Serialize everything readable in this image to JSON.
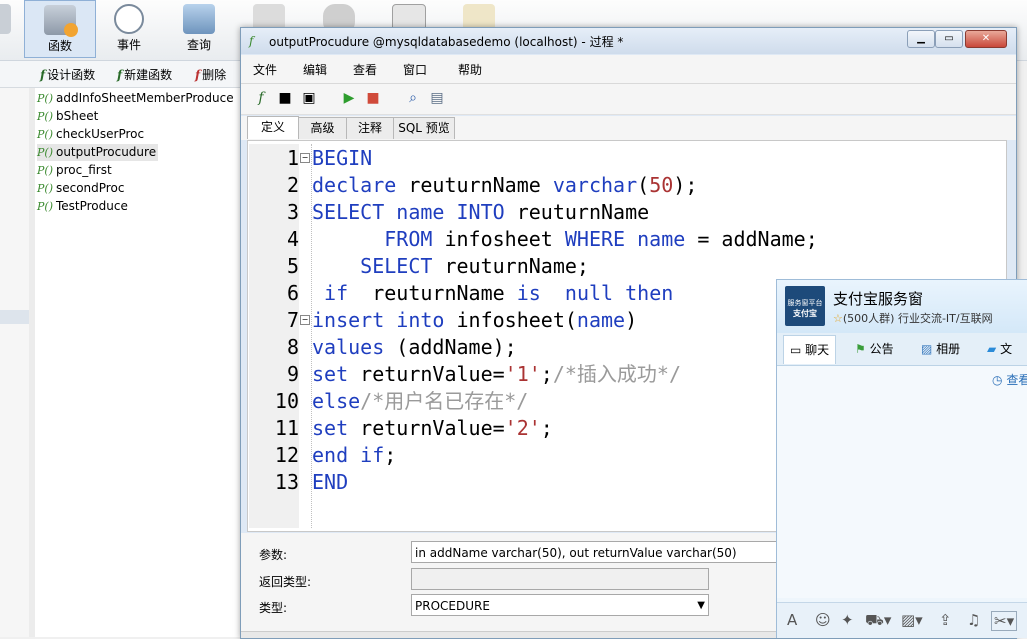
{
  "background_app": {
    "toolbar": [
      {
        "label": "函数",
        "active": true
      },
      {
        "label": "事件",
        "active": false
      },
      {
        "label": "查询",
        "active": false
      }
    ],
    "subbar": {
      "design": "设计函数",
      "new": "新建函数",
      "delete": "删除"
    },
    "procedures": [
      "addInfoSheetMemberProduce",
      "bSheet",
      "checkUserProc",
      "outputProcudure",
      "proc_first",
      "secondProc",
      "TestProduce"
    ],
    "selected_procedure": "outputProcudure"
  },
  "window": {
    "title": "outputProcudure @mysqldatabasedemo (localhost) - 过程 *",
    "menu": [
      "文件",
      "编辑",
      "查看",
      "窗口",
      "帮助"
    ],
    "tabs": [
      {
        "label": "定义",
        "active": true
      },
      {
        "label": "高级",
        "active": false
      },
      {
        "label": "注释",
        "active": false
      },
      {
        "label": "SQL 预览",
        "active": false
      }
    ],
    "code_lines": [
      [
        [
          "kw",
          "BEGIN"
        ]
      ],
      [
        [
          "kw",
          "declare"
        ],
        [
          "tx",
          " reuturnName "
        ],
        [
          "kw",
          "varchar"
        ],
        [
          "tx",
          "("
        ],
        [
          "num",
          "50"
        ],
        [
          "tx",
          ");"
        ]
      ],
      [
        [
          "kw",
          "SELECT"
        ],
        [
          "tx",
          " "
        ],
        [
          "kw",
          "name"
        ],
        [
          "tx",
          " "
        ],
        [
          "kw",
          "INTO"
        ],
        [
          "tx",
          " reuturnName"
        ]
      ],
      [
        [
          "tx",
          "      "
        ],
        [
          "kw",
          "FROM"
        ],
        [
          "tx",
          " infosheet "
        ],
        [
          "kw",
          "WHERE"
        ],
        [
          "tx",
          " "
        ],
        [
          "kw",
          "name"
        ],
        [
          "tx",
          " = addName;"
        ]
      ],
      [
        [
          "tx",
          "    "
        ],
        [
          "kw",
          "SELECT"
        ],
        [
          "tx",
          " reuturnName;"
        ]
      ],
      [
        [
          "tx",
          " "
        ],
        [
          "kw",
          "if"
        ],
        [
          "tx",
          "  reuturnName "
        ],
        [
          "kw",
          "is"
        ],
        [
          "tx",
          "  "
        ],
        [
          "kw",
          "null"
        ],
        [
          "tx",
          " "
        ],
        [
          "kw",
          "then"
        ]
      ],
      [
        [
          "kw",
          "insert"
        ],
        [
          "tx",
          " "
        ],
        [
          "kw",
          "into"
        ],
        [
          "tx",
          " infosheet("
        ],
        [
          "kw",
          "name"
        ],
        [
          "tx",
          ")"
        ]
      ],
      [
        [
          "kw",
          "values"
        ],
        [
          "tx",
          " (addName);"
        ]
      ],
      [
        [
          "kw",
          "set"
        ],
        [
          "tx",
          " returnValue="
        ],
        [
          "str",
          "'1'"
        ],
        [
          "tx",
          ";"
        ],
        [
          "cm",
          "/*插入成功*/"
        ]
      ],
      [
        [
          "kw",
          "else"
        ],
        [
          "cm",
          "/*用户名已存在*/"
        ]
      ],
      [
        [
          "kw",
          "set"
        ],
        [
          "tx",
          " returnValue="
        ],
        [
          "str",
          "'2'"
        ],
        [
          "tx",
          ";"
        ]
      ],
      [
        [
          "kw",
          "end"
        ],
        [
          "tx",
          " "
        ],
        [
          "kw",
          "if"
        ],
        [
          "tx",
          ";"
        ]
      ],
      [
        [
          "kw",
          "END"
        ]
      ]
    ],
    "props": {
      "params_label": "参数:",
      "params_value": "in addName varchar(50), out returnValue varchar(50)",
      "return_label": "返回类型:",
      "return_value": "",
      "type_label": "类型:",
      "type_value": "PROCEDURE"
    }
  },
  "chat": {
    "logo_text": "服务窗平台",
    "logo_brand": "支付宝",
    "title": "支付宝服务窗",
    "subtitle": "(500人群) 行业交流-IT/互联网",
    "tabs": [
      "聊天",
      "公告",
      "相册",
      "文"
    ],
    "link": "查看",
    "colors": {
      "accent": "#2a6fb8"
    }
  }
}
